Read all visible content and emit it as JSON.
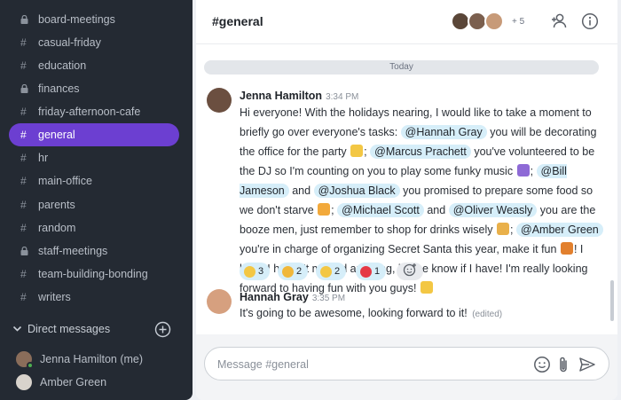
{
  "sidebar": {
    "channels": [
      {
        "name": "board-meetings",
        "locked": true
      },
      {
        "name": "casual-friday",
        "locked": false
      },
      {
        "name": "education",
        "locked": false
      },
      {
        "name": "finances",
        "locked": true
      },
      {
        "name": "friday-afternoon-cafe",
        "locked": false
      },
      {
        "name": "general",
        "locked": false,
        "active": true
      },
      {
        "name": "hr",
        "locked": false
      },
      {
        "name": "main-office",
        "locked": false
      },
      {
        "name": "parents",
        "locked": false
      },
      {
        "name": "random",
        "locked": false
      },
      {
        "name": "staff-meetings",
        "locked": true
      },
      {
        "name": "team-building-bonding",
        "locked": false
      },
      {
        "name": "writers",
        "locked": false
      }
    ],
    "direct_messages_title": "Direct messages",
    "dms": [
      {
        "name": "Jenna Hamilton (me)",
        "online": true
      },
      {
        "name": "Amber Green",
        "online": false
      }
    ]
  },
  "header": {
    "channel_title": "#general",
    "member_more": "+ 5"
  },
  "day_divider": "Today",
  "messages": [
    {
      "author": "Jenna Hamilton",
      "time": "3:34 PM",
      "parts": {
        "p1": "Hi everyone! With the holidays nearing, I would like to take a moment to briefly go over everyone's tasks:",
        "m1": "@Hannah Gray",
        "p2": "you will be decorating the office for the party",
        "p3": ";",
        "m2": "@Marcus Prachett",
        "p4": "you've volunteered to be the DJ so I'm counting on you to play some funky music",
        "p5": ";",
        "m3": "@Bill Jameson",
        "p6": "and",
        "m4": "@Joshua Black",
        "p7": "you promised to prepare some food so we don't starve",
        "p8": ";",
        "m5": "@Michael Scott",
        "p9": "and",
        "m6": "@Oliver Weasly",
        "p10": "you are the booze men, just remember to shop for drinks wisely",
        "p11": ";",
        "m7": "@Amber Green",
        "p12": "you're in charge of organizing Secret Santa this year, make it fun",
        "p13": "! I hope I haven't missed anything, let me know if I have! I'm really looking forward to having fun with you guys!"
      },
      "reactions": [
        {
          "emoji": "thumbs-up",
          "count": "3"
        },
        {
          "emoji": "star-struck",
          "count": "2"
        },
        {
          "emoji": "partying-face",
          "count": "2"
        },
        {
          "emoji": "heart",
          "count": "1"
        }
      ]
    },
    {
      "author": "Hannah Gray",
      "time": "3:35 PM",
      "text": "It's going to be awesome, looking forward to it!",
      "edited": "(edited)"
    }
  ],
  "composer": {
    "placeholder": "Message #general"
  },
  "colors": {
    "sidebar_bg": "#242a33",
    "active_channel": "#6c3fd1",
    "mention_bg": "#d6eef9",
    "online": "#4caf50"
  }
}
